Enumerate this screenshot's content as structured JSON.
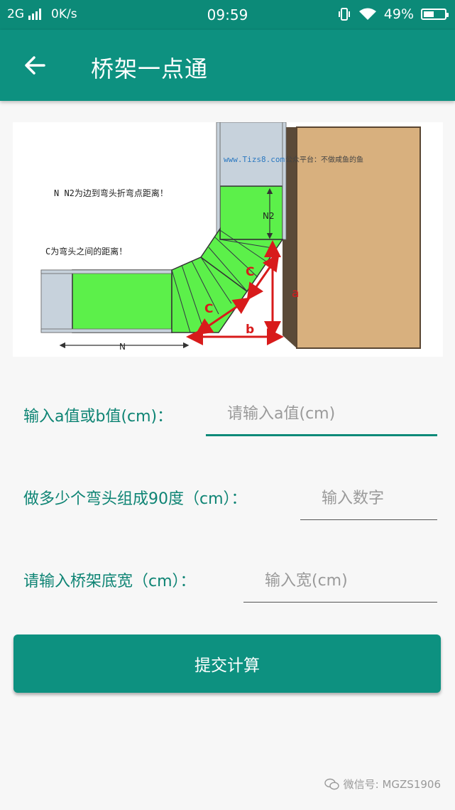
{
  "status_bar": {
    "network": "2G",
    "speed": "0K/s",
    "time": "09:59",
    "battery": "49%",
    "battery_level": 0.49
  },
  "app_bar": {
    "title": "桥架一点通"
  },
  "diagram": {
    "watermark_url": "www.Tizs8.com",
    "watermark_text": "公众平台：不做咸鱼的鱼",
    "note_n": "N N2为边到弯头折弯点距离！",
    "note_c": "C为弯头之间的距离！",
    "label_n2": "N2",
    "label_c": "C",
    "label_a": "a",
    "label_b": "b",
    "label_n": "N"
  },
  "form": {
    "field_ab": {
      "label": "输入a值或b值(cm)：",
      "placeholder": "请输入a值(cm)",
      "value": ""
    },
    "field_count": {
      "label": "做多少个弯头组成90度（cm）：",
      "placeholder": "输入数字",
      "value": ""
    },
    "field_width": {
      "label": "请输入桥架底宽（cm）：",
      "placeholder": "输入宽(cm)",
      "value": ""
    },
    "submit_label": "提交计算"
  },
  "footer": {
    "watermark": "微信号: MGZS1906"
  },
  "colors": {
    "primary": "#0d9180",
    "accent": "#0e8474",
    "green": "#5cf04a",
    "red": "#d81b1b"
  }
}
